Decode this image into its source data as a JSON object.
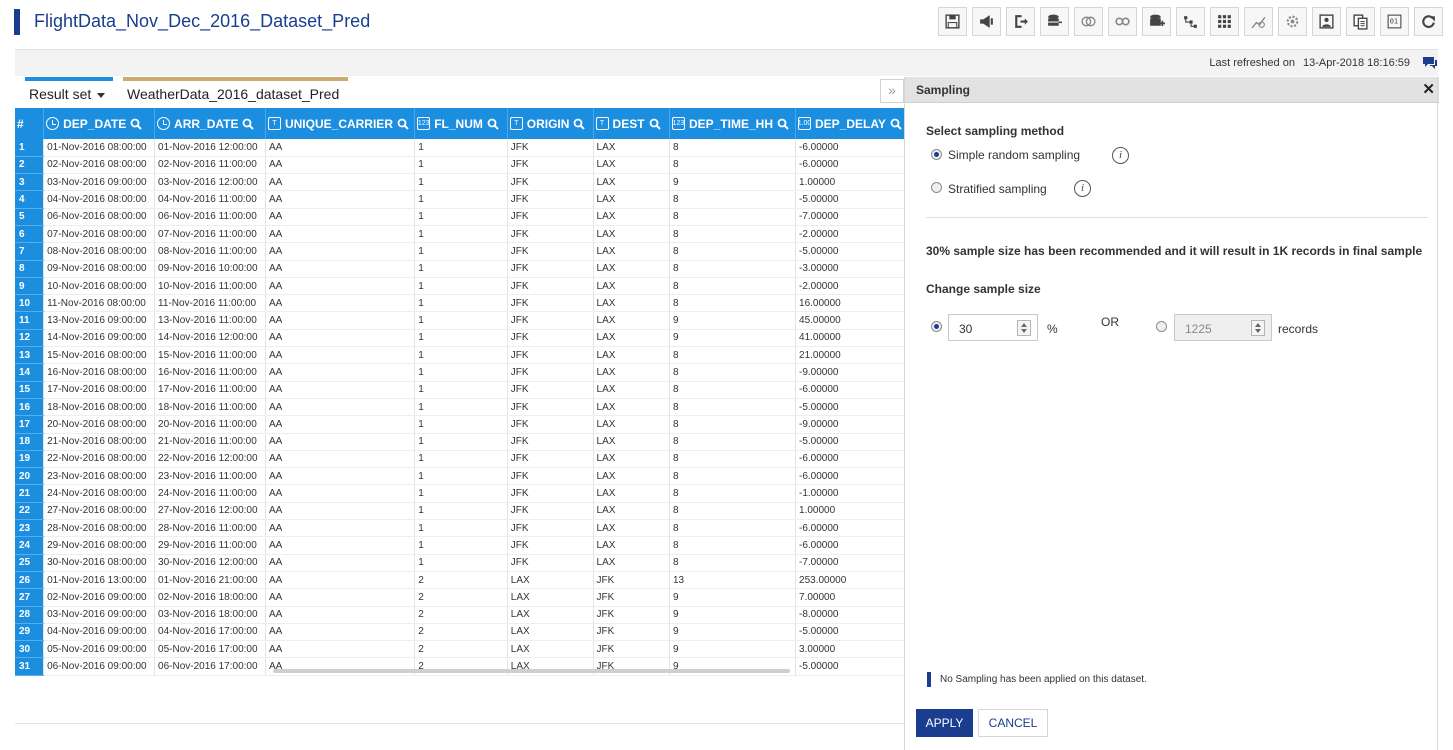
{
  "header": {
    "title": "FlightData_Nov_Dec_2016_Dataset_Pred",
    "toolbar_icons": [
      "save-icon",
      "publish-icon",
      "export-icon",
      "database-icon",
      "join-icon",
      "link-icon",
      "add-data-icon",
      "hierarchy-icon",
      "grid-icon",
      "chart-icon",
      "settings-icon",
      "image-icon",
      "copy-icon",
      "binary-icon",
      "refresh-icon"
    ]
  },
  "refresh": {
    "label": "Last refreshed on",
    "timestamp": "13-Apr-2018 18:16:59"
  },
  "tabs": {
    "result_set": "Result set",
    "weather": "WeatherData_2016_dataset_Pred"
  },
  "grid": {
    "rownum_header": "#",
    "columns": [
      {
        "name": "DEP_DATE",
        "type": "clock"
      },
      {
        "name": "ARR_DATE",
        "type": "clock"
      },
      {
        "name": "UNIQUE_CARRIER",
        "type": "T"
      },
      {
        "name": "FL_NUM",
        "type": "123"
      },
      {
        "name": "ORIGIN",
        "type": "T"
      },
      {
        "name": "DEST",
        "type": "T"
      },
      {
        "name": "DEP_TIME_HH",
        "type": "123"
      },
      {
        "name": "DEP_DELAY",
        "type": "1.00"
      }
    ],
    "rows": [
      [
        "1",
        "01-Nov-2016 08:00:00",
        "01-Nov-2016 12:00:00",
        "AA",
        "1",
        "JFK",
        "LAX",
        "8",
        "-6.00000"
      ],
      [
        "2",
        "02-Nov-2016 08:00:00",
        "02-Nov-2016 11:00:00",
        "AA",
        "1",
        "JFK",
        "LAX",
        "8",
        "-6.00000"
      ],
      [
        "3",
        "03-Nov-2016 09:00:00",
        "03-Nov-2016 12:00:00",
        "AA",
        "1",
        "JFK",
        "LAX",
        "9",
        "1.00000"
      ],
      [
        "4",
        "04-Nov-2016 08:00:00",
        "04-Nov-2016 11:00:00",
        "AA",
        "1",
        "JFK",
        "LAX",
        "8",
        "-5.00000"
      ],
      [
        "5",
        "06-Nov-2016 08:00:00",
        "06-Nov-2016 11:00:00",
        "AA",
        "1",
        "JFK",
        "LAX",
        "8",
        "-7.00000"
      ],
      [
        "6",
        "07-Nov-2016 08:00:00",
        "07-Nov-2016 11:00:00",
        "AA",
        "1",
        "JFK",
        "LAX",
        "8",
        "-2.00000"
      ],
      [
        "7",
        "08-Nov-2016 08:00:00",
        "08-Nov-2016 11:00:00",
        "AA",
        "1",
        "JFK",
        "LAX",
        "8",
        "-5.00000"
      ],
      [
        "8",
        "09-Nov-2016 08:00:00",
        "09-Nov-2016 10:00:00",
        "AA",
        "1",
        "JFK",
        "LAX",
        "8",
        "-3.00000"
      ],
      [
        "9",
        "10-Nov-2016 08:00:00",
        "10-Nov-2016 11:00:00",
        "AA",
        "1",
        "JFK",
        "LAX",
        "8",
        "-2.00000"
      ],
      [
        "10",
        "11-Nov-2016 08:00:00",
        "11-Nov-2016 11:00:00",
        "AA",
        "1",
        "JFK",
        "LAX",
        "8",
        "16.00000"
      ],
      [
        "11",
        "13-Nov-2016 09:00:00",
        "13-Nov-2016 11:00:00",
        "AA",
        "1",
        "JFK",
        "LAX",
        "9",
        "45.00000"
      ],
      [
        "12",
        "14-Nov-2016 09:00:00",
        "14-Nov-2016 12:00:00",
        "AA",
        "1",
        "JFK",
        "LAX",
        "9",
        "41.00000"
      ],
      [
        "13",
        "15-Nov-2016 08:00:00",
        "15-Nov-2016 11:00:00",
        "AA",
        "1",
        "JFK",
        "LAX",
        "8",
        "21.00000"
      ],
      [
        "14",
        "16-Nov-2016 08:00:00",
        "16-Nov-2016 11:00:00",
        "AA",
        "1",
        "JFK",
        "LAX",
        "8",
        "-9.00000"
      ],
      [
        "15",
        "17-Nov-2016 08:00:00",
        "17-Nov-2016 11:00:00",
        "AA",
        "1",
        "JFK",
        "LAX",
        "8",
        "-6.00000"
      ],
      [
        "16",
        "18-Nov-2016 08:00:00",
        "18-Nov-2016 11:00:00",
        "AA",
        "1",
        "JFK",
        "LAX",
        "8",
        "-5.00000"
      ],
      [
        "17",
        "20-Nov-2016 08:00:00",
        "20-Nov-2016 11:00:00",
        "AA",
        "1",
        "JFK",
        "LAX",
        "8",
        "-9.00000"
      ],
      [
        "18",
        "21-Nov-2016 08:00:00",
        "21-Nov-2016 11:00:00",
        "AA",
        "1",
        "JFK",
        "LAX",
        "8",
        "-5.00000"
      ],
      [
        "19",
        "22-Nov-2016 08:00:00",
        "22-Nov-2016 12:00:00",
        "AA",
        "1",
        "JFK",
        "LAX",
        "8",
        "-6.00000"
      ],
      [
        "20",
        "23-Nov-2016 08:00:00",
        "23-Nov-2016 11:00:00",
        "AA",
        "1",
        "JFK",
        "LAX",
        "8",
        "-6.00000"
      ],
      [
        "21",
        "24-Nov-2016 08:00:00",
        "24-Nov-2016 11:00:00",
        "AA",
        "1",
        "JFK",
        "LAX",
        "8",
        "-1.00000"
      ],
      [
        "22",
        "27-Nov-2016 08:00:00",
        "27-Nov-2016 12:00:00",
        "AA",
        "1",
        "JFK",
        "LAX",
        "8",
        "1.00000"
      ],
      [
        "23",
        "28-Nov-2016 08:00:00",
        "28-Nov-2016 11:00:00",
        "AA",
        "1",
        "JFK",
        "LAX",
        "8",
        "-6.00000"
      ],
      [
        "24",
        "29-Nov-2016 08:00:00",
        "29-Nov-2016 11:00:00",
        "AA",
        "1",
        "JFK",
        "LAX",
        "8",
        "-6.00000"
      ],
      [
        "25",
        "30-Nov-2016 08:00:00",
        "30-Nov-2016 12:00:00",
        "AA",
        "1",
        "JFK",
        "LAX",
        "8",
        "-7.00000"
      ],
      [
        "26",
        "01-Nov-2016 13:00:00",
        "01-Nov-2016 21:00:00",
        "AA",
        "2",
        "LAX",
        "JFK",
        "13",
        "253.00000"
      ],
      [
        "27",
        "02-Nov-2016 09:00:00",
        "02-Nov-2016 18:00:00",
        "AA",
        "2",
        "LAX",
        "JFK",
        "9",
        "7.00000"
      ],
      [
        "28",
        "03-Nov-2016 09:00:00",
        "03-Nov-2016 18:00:00",
        "AA",
        "2",
        "LAX",
        "JFK",
        "9",
        "-8.00000"
      ],
      [
        "29",
        "04-Nov-2016 09:00:00",
        "04-Nov-2016 17:00:00",
        "AA",
        "2",
        "LAX",
        "JFK",
        "9",
        "-5.00000"
      ],
      [
        "30",
        "05-Nov-2016 09:00:00",
        "05-Nov-2016 17:00:00",
        "AA",
        "2",
        "LAX",
        "JFK",
        "9",
        "3.00000"
      ],
      [
        "31",
        "06-Nov-2016 09:00:00",
        "06-Nov-2016 17:00:00",
        "AA",
        "2",
        "LAX",
        "JFK",
        "9",
        "-5.00000"
      ]
    ]
  },
  "sampling": {
    "title": "Sampling",
    "method_label": "Select sampling method",
    "simple_label": "Simple random sampling",
    "stratified_label": "Stratified sampling",
    "recommendation": "30% sample size has been recommended and it will result in 1K records in final sample",
    "change_label": "Change sample size",
    "percent_value": "30",
    "percent_unit": "%",
    "or_label": "OR",
    "records_value": "1225",
    "records_unit": "records",
    "note": "No Sampling has been applied on this dataset.",
    "apply": "APPLY",
    "cancel": "CANCEL"
  },
  "colors": {
    "primary": "#1a3d8f",
    "grid_header": "#1b8ee0",
    "tab_weather": "#c9ab6e"
  }
}
